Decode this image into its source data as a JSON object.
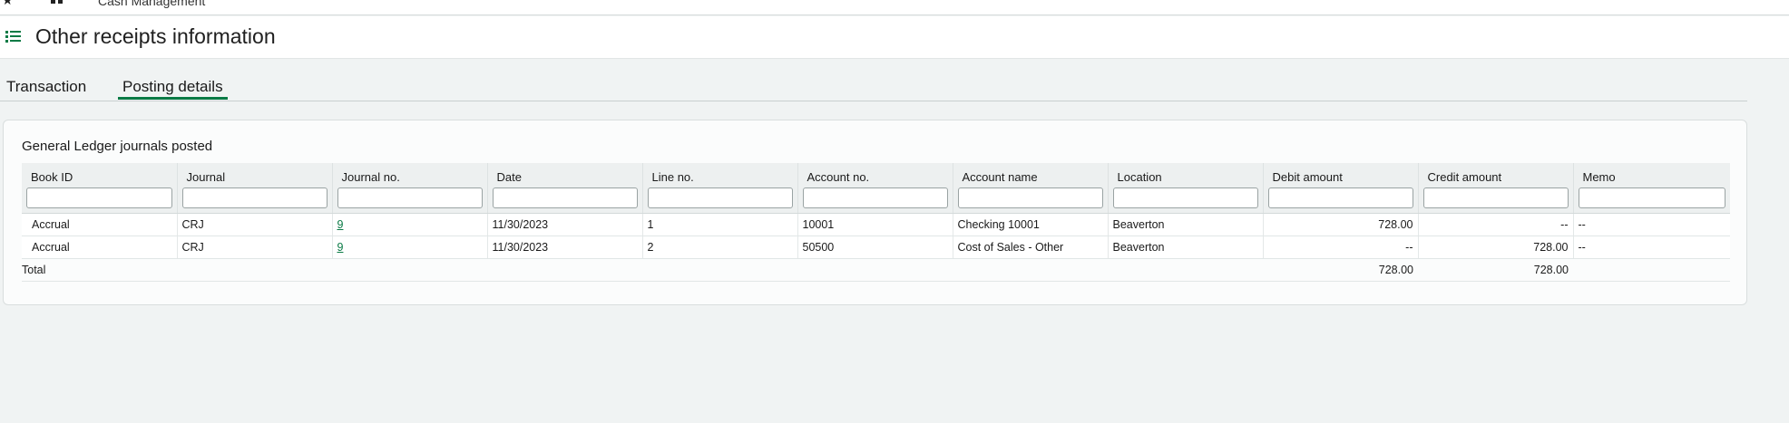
{
  "header": {
    "breadcrumb": "Cash Management"
  },
  "page": {
    "title": "Other receipts information"
  },
  "tabs": [
    {
      "label": "Transaction",
      "active": false
    },
    {
      "label": "Posting details",
      "active": true
    }
  ],
  "section": {
    "title": "General Ledger journals posted"
  },
  "table": {
    "columns": [
      "Book ID",
      "Journal",
      "Journal no.",
      "Date",
      "Line no.",
      "Account no.",
      "Account name",
      "Location",
      "Debit amount",
      "Credit amount",
      "Memo"
    ],
    "rows": [
      [
        "Accrual",
        "CRJ",
        "9",
        "11/30/2023",
        "1",
        "10001",
        "Checking 10001",
        "Beaverton",
        "728.00",
        "--",
        "--"
      ],
      [
        "Accrual",
        "CRJ",
        "9",
        "11/30/2023",
        "2",
        "50500",
        "Cost of Sales - Other",
        "Beaverton",
        "--",
        "728.00",
        "--"
      ]
    ],
    "total": {
      "label": "Total",
      "debit": "728.00",
      "credit": "728.00"
    }
  },
  "colors": {
    "accent": "#0a7a45",
    "background": "#f0f3f3"
  },
  "icons": [
    "star-icon",
    "grid-icon",
    "menu-list-icon"
  ]
}
